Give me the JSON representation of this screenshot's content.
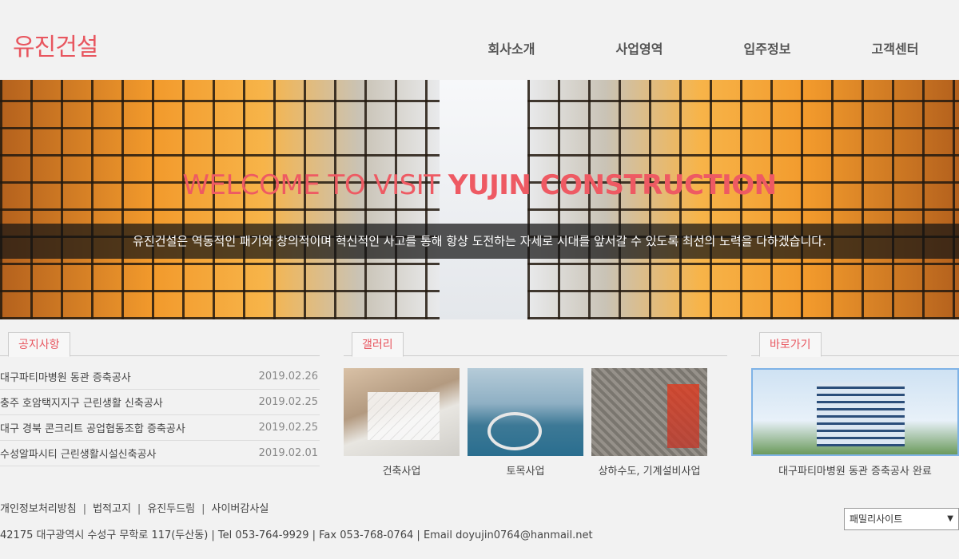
{
  "header": {
    "logo": "유진건설",
    "nav": [
      "회사소개",
      "사업영역",
      "입주정보",
      "고객센터"
    ]
  },
  "hero": {
    "title_light": "WELCOME TO VISIT ",
    "title_bold": "YUJIN CONSTRUCTION",
    "tagline": "유진건설은 역동적인 패기와 창의적이며 혁신적인 사고를 통해 항상 도전하는 자세로 시대를 앞서갈 수 있도록 최선의 노력을 다하겠습니다."
  },
  "notice": {
    "title": "공지사항",
    "items": [
      {
        "title": "대구파티마병원 동관 증축공사",
        "date": "2019.02.26"
      },
      {
        "title": "충주 호암택지지구 근린생활 신축공사",
        "date": "2019.02.25"
      },
      {
        "title": "대구 경북 콘크리트 공업협동조합 증축공사",
        "date": "2019.02.25"
      },
      {
        "title": "수성알파시티 근린생활시설신축공사",
        "date": "2019.02.01"
      }
    ]
  },
  "gallery": {
    "title": "갤러리",
    "items": [
      {
        "caption": "건축사업"
      },
      {
        "caption": "토목사업"
      },
      {
        "caption": "상하수도, 기계설비사업"
      }
    ]
  },
  "shortcut": {
    "title": "바로가기",
    "caption": "대구파티마병원 동관 증축공사 완료"
  },
  "footer": {
    "links": [
      "개인정보처리방침",
      "법적고지",
      "유진두드림",
      "사이버감사실"
    ],
    "address": "42175 대구광역시 수성구 무학로 117(두산동) | Tel 053-764-9929 | Fax 053-768-0764 | Email doyujin0764@hanmail.net",
    "family_site": "패밀리사이트"
  },
  "colors": {
    "accent": "#e8565f",
    "background": "#f2f2f2"
  }
}
